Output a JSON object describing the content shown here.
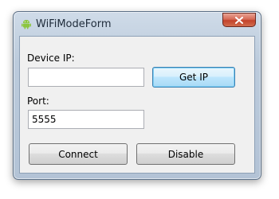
{
  "window": {
    "title": "WiFiModeForm",
    "icon": "android-icon",
    "close_glyph": "close-icon"
  },
  "form": {
    "device_ip_label": "Device IP:",
    "device_ip_value": "",
    "get_ip_label": "Get IP",
    "port_label": "Port:",
    "port_value": "5555",
    "connect_label": "Connect",
    "disable_label": "Disable"
  },
  "colors": {
    "accent": "#3c7fb1",
    "close_button": "#c2432b"
  }
}
